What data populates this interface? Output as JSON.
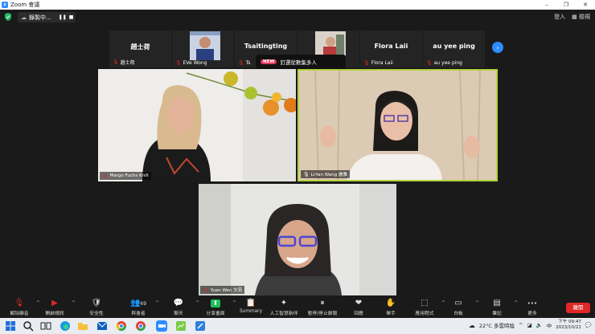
{
  "window": {
    "title": "Zoom 會議",
    "controls": [
      "–",
      "❐",
      "✕"
    ]
  },
  "topbar": {
    "recording_label": "錄製中...",
    "signin": "登入",
    "view": "檢視"
  },
  "strip": {
    "tiles": [
      {
        "display_name": "趙士荷",
        "label": "趙士荷"
      },
      {
        "display_name": "",
        "label": "EVe Wong"
      },
      {
        "display_name": "Tsaitingting",
        "label": "Ts"
      },
      {
        "display_name": "",
        "label": ""
      },
      {
        "display_name": "Flora Laii",
        "label": "Flora Laii"
      },
      {
        "display_name": "au yee ping",
        "label": "au yee ping"
      }
    ],
    "banner_tag": "NEW",
    "banner_text": "釘選從數集多人"
  },
  "videos": {
    "v1": {
      "label": "Margo Fuchs Knill"
    },
    "v2": {
      "label": "Li-Yan Wang 麗雅"
    },
    "v3": {
      "label": "Yuan Wen 文苑"
    }
  },
  "toolbar": {
    "items": [
      {
        "icon": "🎙",
        "label": "解除靜音"
      },
      {
        "icon": "▶",
        "label": "開啟視訊"
      },
      {
        "icon": "🛡",
        "label": "安全性"
      },
      {
        "icon": "👥",
        "label": "與會者",
        "count": "69"
      },
      {
        "icon": "💬",
        "label": "聊天"
      },
      {
        "icon": "⬆",
        "label": "分享畫面"
      },
      {
        "icon": "📋",
        "label": "Summary"
      },
      {
        "icon": "✦",
        "label": "人工智慧新伴"
      },
      {
        "icon": "⏸",
        "label": "暫停/停止錄製"
      },
      {
        "icon": "❤",
        "label": "回應"
      },
      {
        "icon": "✋",
        "label": "舉手"
      },
      {
        "icon": "⬚",
        "label": "應用程式"
      },
      {
        "icon": "▭",
        "label": "白板"
      },
      {
        "icon": "▤",
        "label": "筆記"
      },
      {
        "icon": "•••",
        "label": "更多"
      }
    ],
    "end_label": "離開"
  },
  "taskbar": {
    "weather": "22°C 多雲時陰",
    "ime": "中",
    "time": "下午 09:47",
    "date": "2023/10/21"
  },
  "colors": {
    "accent": "#2d8cff",
    "end": "#e02828",
    "speaker_border": "#b3d340",
    "share": "#1fbf5a"
  }
}
